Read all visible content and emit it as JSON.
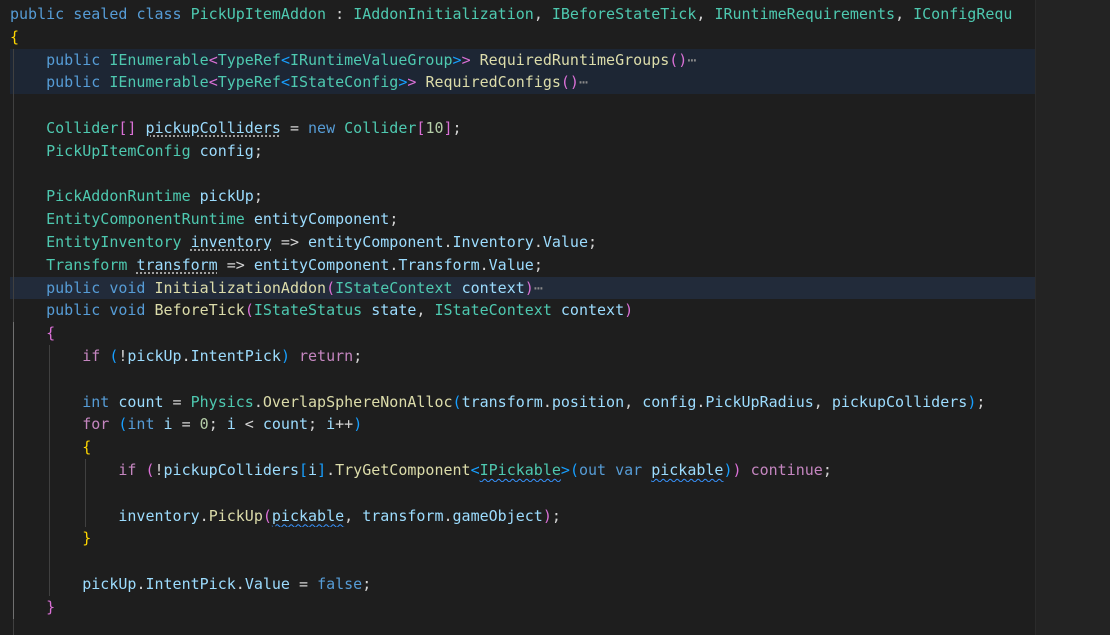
{
  "editor": {
    "language": "csharp",
    "indent_width": 4,
    "lines": [
      {
        "indent": 0,
        "highlight": "",
        "tokens": [
          [
            "kw",
            "public"
          ],
          [
            "pl",
            " "
          ],
          [
            "kw",
            "sealed"
          ],
          [
            "pl",
            " "
          ],
          [
            "kw",
            "class"
          ],
          [
            "pl",
            " "
          ],
          [
            "ty",
            "PickUpItemAddon"
          ],
          [
            "pl",
            " : "
          ],
          [
            "ty",
            "IAddonInitialization"
          ],
          [
            "pl",
            ", "
          ],
          [
            "ty",
            "IBeforeStateTick"
          ],
          [
            "pl",
            ", "
          ],
          [
            "ty",
            "IRuntimeRequirements"
          ],
          [
            "pl",
            ", "
          ],
          [
            "ty",
            "IConfigRequ"
          ]
        ]
      },
      {
        "indent": 0,
        "highlight": "",
        "tokens": [
          [
            "b1",
            "{"
          ]
        ]
      },
      {
        "indent": 1,
        "highlight": "hl",
        "tokens": [
          [
            "kw",
            "public"
          ],
          [
            "pl",
            " "
          ],
          [
            "ty",
            "IEnumerable"
          ],
          [
            "b2",
            "<"
          ],
          [
            "ty",
            "TypeRef"
          ],
          [
            "b3",
            "<"
          ],
          [
            "ty",
            "IRuntimeValueGroup"
          ],
          [
            "b3",
            ">"
          ],
          [
            "b2",
            ">"
          ],
          [
            "pl",
            " "
          ],
          [
            "fn",
            "RequiredRuntimeGroups"
          ],
          [
            "b2",
            "()"
          ],
          [
            "fold",
            "⋯"
          ]
        ]
      },
      {
        "indent": 1,
        "highlight": "hl",
        "tokens": [
          [
            "kw",
            "public"
          ],
          [
            "pl",
            " "
          ],
          [
            "ty",
            "IEnumerable"
          ],
          [
            "b2",
            "<"
          ],
          [
            "ty",
            "TypeRef"
          ],
          [
            "b3",
            "<"
          ],
          [
            "ty",
            "IStateConfig"
          ],
          [
            "b3",
            ">"
          ],
          [
            "b2",
            ">"
          ],
          [
            "pl",
            " "
          ],
          [
            "fn",
            "RequiredConfigs"
          ],
          [
            "b2",
            "()"
          ],
          [
            "fold",
            "⋯"
          ]
        ]
      },
      {
        "indent": 1,
        "highlight": "",
        "tokens": []
      },
      {
        "indent": 1,
        "highlight": "",
        "tokens": [
          [
            "ty",
            "Collider"
          ],
          [
            "b2",
            "[]"
          ],
          [
            "pl",
            " "
          ],
          [
            "var",
            "pickupColliders",
            "dots"
          ],
          [
            "pl",
            " = "
          ],
          [
            "kw",
            "new"
          ],
          [
            "pl",
            " "
          ],
          [
            "ty",
            "Collider"
          ],
          [
            "b2",
            "["
          ],
          [
            "num",
            "10"
          ],
          [
            "b2",
            "]"
          ],
          [
            "pl",
            ";"
          ]
        ]
      },
      {
        "indent": 1,
        "highlight": "",
        "tokens": [
          [
            "ty",
            "PickUpItemConfig"
          ],
          [
            "pl",
            " "
          ],
          [
            "var",
            "config"
          ],
          [
            "pl",
            ";"
          ]
        ]
      },
      {
        "indent": 1,
        "highlight": "",
        "tokens": []
      },
      {
        "indent": 1,
        "highlight": "",
        "tokens": [
          [
            "ty",
            "PickAddonRuntime"
          ],
          [
            "pl",
            " "
          ],
          [
            "var",
            "pickUp"
          ],
          [
            "pl",
            ";"
          ]
        ]
      },
      {
        "indent": 1,
        "highlight": "",
        "tokens": [
          [
            "ty",
            "EntityComponentRuntime"
          ],
          [
            "pl",
            " "
          ],
          [
            "var",
            "entityComponent"
          ],
          [
            "pl",
            ";"
          ]
        ]
      },
      {
        "indent": 1,
        "highlight": "",
        "tokens": [
          [
            "ty",
            "EntityInventory"
          ],
          [
            "pl",
            " "
          ],
          [
            "var",
            "inventory",
            "dots"
          ],
          [
            "pl",
            " => "
          ],
          [
            "var",
            "entityComponent"
          ],
          [
            "pl",
            "."
          ],
          [
            "var",
            "Inventory"
          ],
          [
            "pl",
            "."
          ],
          [
            "var",
            "Value"
          ],
          [
            "pl",
            ";"
          ]
        ]
      },
      {
        "indent": 1,
        "highlight": "",
        "tokens": [
          [
            "ty",
            "Transform"
          ],
          [
            "pl",
            " "
          ],
          [
            "var",
            "transform",
            "dots"
          ],
          [
            "pl",
            " => "
          ],
          [
            "var",
            "entityComponent"
          ],
          [
            "pl",
            "."
          ],
          [
            "var",
            "Transform"
          ],
          [
            "pl",
            "."
          ],
          [
            "var",
            "Value"
          ],
          [
            "pl",
            ";"
          ]
        ]
      },
      {
        "indent": 1,
        "highlight": "hl-strong",
        "tokens": [
          [
            "kw",
            "public"
          ],
          [
            "pl",
            " "
          ],
          [
            "kw",
            "void"
          ],
          [
            "pl",
            " "
          ],
          [
            "fn",
            "InitializationAddon"
          ],
          [
            "b2",
            "("
          ],
          [
            "ty",
            "IStateContext"
          ],
          [
            "pl",
            " "
          ],
          [
            "var",
            "context"
          ],
          [
            "b2",
            ")"
          ],
          [
            "fold",
            "⋯"
          ]
        ]
      },
      {
        "indent": 1,
        "highlight": "",
        "tokens": [
          [
            "kw",
            "public"
          ],
          [
            "pl",
            " "
          ],
          [
            "kw",
            "void"
          ],
          [
            "pl",
            " "
          ],
          [
            "fn",
            "BeforeTick"
          ],
          [
            "b2",
            "("
          ],
          [
            "ty",
            "IStateStatus"
          ],
          [
            "pl",
            " "
          ],
          [
            "var",
            "state"
          ],
          [
            "pl",
            ", "
          ],
          [
            "ty",
            "IStateContext"
          ],
          [
            "pl",
            " "
          ],
          [
            "var",
            "context"
          ],
          [
            "b2",
            ")"
          ]
        ]
      },
      {
        "indent": 1,
        "highlight": "",
        "tokens": [
          [
            "b2",
            "{"
          ]
        ]
      },
      {
        "indent": 2,
        "highlight": "",
        "tokens": [
          [
            "ctl",
            "if"
          ],
          [
            "pl",
            " "
          ],
          [
            "b3",
            "("
          ],
          [
            "pl",
            "!"
          ],
          [
            "var",
            "pickUp"
          ],
          [
            "pl",
            "."
          ],
          [
            "var",
            "IntentPick"
          ],
          [
            "b3",
            ")"
          ],
          [
            "pl",
            " "
          ],
          [
            "ctl",
            "return"
          ],
          [
            "pl",
            ";"
          ]
        ]
      },
      {
        "indent": 2,
        "highlight": "",
        "tokens": []
      },
      {
        "indent": 2,
        "highlight": "",
        "tokens": [
          [
            "kw",
            "int"
          ],
          [
            "pl",
            " "
          ],
          [
            "var",
            "count"
          ],
          [
            "pl",
            " = "
          ],
          [
            "ty",
            "Physics"
          ],
          [
            "pl",
            "."
          ],
          [
            "fn",
            "OverlapSphereNonAlloc"
          ],
          [
            "b3",
            "("
          ],
          [
            "var",
            "transform"
          ],
          [
            "pl",
            "."
          ],
          [
            "var",
            "position"
          ],
          [
            "pl",
            ", "
          ],
          [
            "var",
            "config"
          ],
          [
            "pl",
            "."
          ],
          [
            "var",
            "PickUpRadius"
          ],
          [
            "pl",
            ", "
          ],
          [
            "var",
            "pickupColliders"
          ],
          [
            "b3",
            ")"
          ],
          [
            "pl",
            ";"
          ]
        ]
      },
      {
        "indent": 2,
        "highlight": "",
        "tokens": [
          [
            "ctl",
            "for"
          ],
          [
            "pl",
            " "
          ],
          [
            "b3",
            "("
          ],
          [
            "kw",
            "int"
          ],
          [
            "pl",
            " "
          ],
          [
            "var",
            "i"
          ],
          [
            "pl",
            " = "
          ],
          [
            "num",
            "0"
          ],
          [
            "pl",
            "; "
          ],
          [
            "var",
            "i"
          ],
          [
            "pl",
            " < "
          ],
          [
            "var",
            "count"
          ],
          [
            "pl",
            "; "
          ],
          [
            "var",
            "i"
          ],
          [
            "pl",
            "++"
          ],
          [
            "b3",
            ")"
          ]
        ]
      },
      {
        "indent": 2,
        "highlight": "",
        "tokens": [
          [
            "b1",
            "{"
          ]
        ]
      },
      {
        "indent": 3,
        "highlight": "",
        "tokens": [
          [
            "ctl",
            "if"
          ],
          [
            "pl",
            " "
          ],
          [
            "b2",
            "("
          ],
          [
            "pl",
            "!"
          ],
          [
            "var",
            "pickupColliders"
          ],
          [
            "b3",
            "["
          ],
          [
            "var",
            "i"
          ],
          [
            "b3",
            "]"
          ],
          [
            "pl",
            "."
          ],
          [
            "fn",
            "TryGetComponent"
          ],
          [
            "b3",
            "<"
          ],
          [
            "ty",
            "IPickable",
            "squig"
          ],
          [
            "b3",
            ">"
          ],
          [
            "b3",
            "("
          ],
          [
            "kw",
            "out"
          ],
          [
            "pl",
            " "
          ],
          [
            "kw",
            "var"
          ],
          [
            "pl",
            " "
          ],
          [
            "var",
            "pickable",
            "squig"
          ],
          [
            "b3",
            ")"
          ],
          [
            "b2",
            ")"
          ],
          [
            "pl",
            " "
          ],
          [
            "ctl",
            "continue"
          ],
          [
            "pl",
            ";"
          ]
        ]
      },
      {
        "indent": 3,
        "highlight": "",
        "tokens": []
      },
      {
        "indent": 3,
        "highlight": "",
        "tokens": [
          [
            "var",
            "inventory"
          ],
          [
            "pl",
            "."
          ],
          [
            "fn",
            "PickUp"
          ],
          [
            "b2",
            "("
          ],
          [
            "var",
            "pickable",
            "squig"
          ],
          [
            "pl",
            ", "
          ],
          [
            "var",
            "transform"
          ],
          [
            "pl",
            "."
          ],
          [
            "var",
            "gameObject"
          ],
          [
            "b2",
            ")"
          ],
          [
            "pl",
            ";"
          ]
        ]
      },
      {
        "indent": 2,
        "highlight": "",
        "tokens": [
          [
            "b1",
            "}"
          ]
        ]
      },
      {
        "indent": 2,
        "highlight": "",
        "tokens": []
      },
      {
        "indent": 2,
        "highlight": "",
        "tokens": [
          [
            "var",
            "pickUp"
          ],
          [
            "pl",
            "."
          ],
          [
            "var",
            "IntentPick"
          ],
          [
            "pl",
            "."
          ],
          [
            "var",
            "Value"
          ],
          [
            "pl",
            " = "
          ],
          [
            "kw",
            "false"
          ],
          [
            "pl",
            ";"
          ]
        ]
      },
      {
        "indent": 1,
        "highlight": "",
        "tokens": [
          [
            "b2",
            "}"
          ]
        ]
      },
      {
        "indent": 1,
        "highlight": "",
        "tokens": []
      }
    ]
  }
}
